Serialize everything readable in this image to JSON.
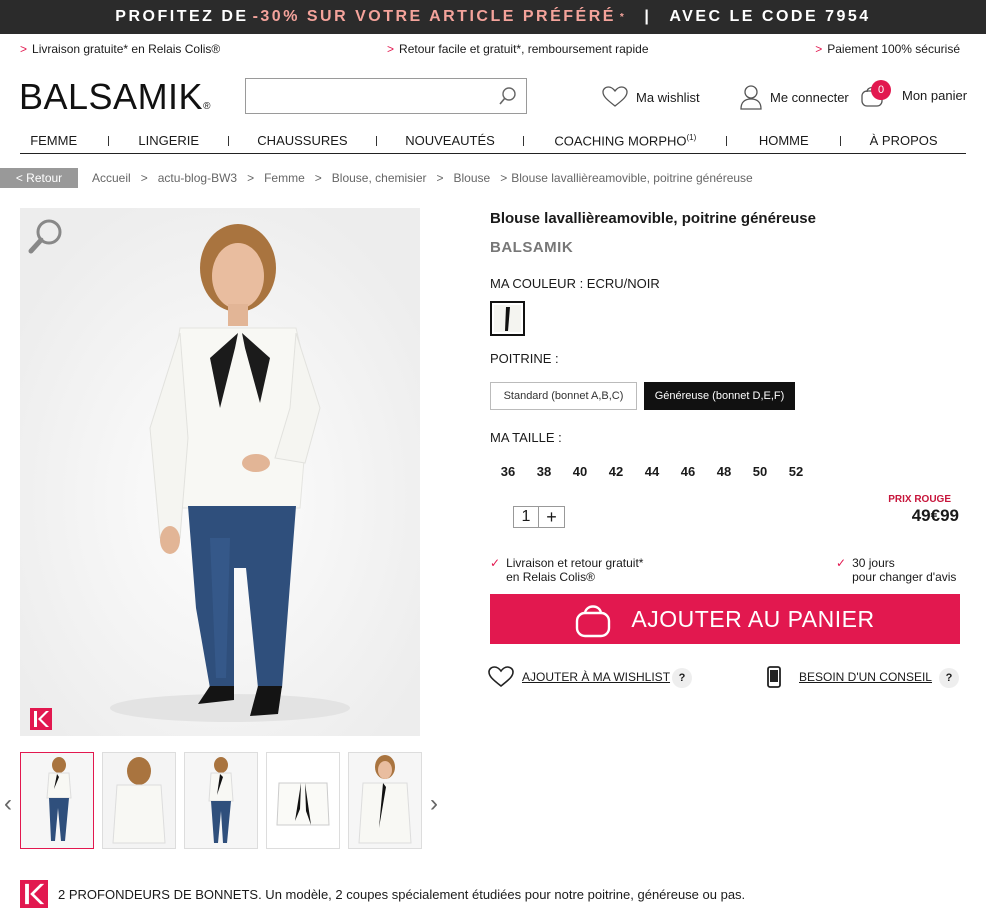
{
  "promo": {
    "part1": "PROFITEZ DE",
    "accent": "-30% SUR VOTRE ARTICLE PRÉFÉRÉ",
    "star": "*",
    "sep": "|",
    "part2": "AVEC LE CODE 7954"
  },
  "infobar": {
    "chevron": ">",
    "items": [
      "Livraison gratuite* en Relais Colis®",
      "Retour facile et gratuit*, remboursement rapide",
      "Paiement 100% sécurisé"
    ]
  },
  "header": {
    "logo": "BALSAMIK",
    "logo_reg": "®",
    "search_placeholder": "",
    "wishlist": "Ma wishlist",
    "login": "Me connecter",
    "cart_count": "0",
    "cart": "Mon panier"
  },
  "nav": {
    "items": [
      "FEMME",
      "LINGERIE",
      "CHAUSSURES",
      "NOUVEAUTÉS",
      "COACHING MORPHO",
      "HOMME",
      "À PROPOS"
    ],
    "coaching_sup": "(1)"
  },
  "breadcrumb": {
    "back": "< Retour",
    "sep": ">",
    "items": [
      "Accueil",
      "actu-blog-BW3",
      "Femme",
      "Blouse, chemisier",
      "Blouse",
      "Blouse lavallièreamovible, poitrine généreuse"
    ]
  },
  "product": {
    "title": "Blouse lavallièreamovible, poitrine généreuse",
    "brand": "BALSAMIK",
    "color_label": "MA COULEUR : ECRU/NOIR",
    "bust_label": "POITRINE :",
    "bust_options": [
      "Standard (bonnet A,B,C)",
      "Généreuse (bonnet D,E,F)"
    ],
    "size_label": "MA TAILLE :",
    "sizes": [
      "36",
      "38",
      "40",
      "42",
      "44",
      "46",
      "48",
      "50",
      "52"
    ],
    "quantity": "1",
    "plus": "+",
    "price_label": "PRIX ROUGE",
    "price": "49€99",
    "tick": "✓",
    "delivery_line1": "Livraison et retour gratuit*",
    "delivery_line2": "en Relais Colis®",
    "returns_line1": "30 jours",
    "returns_line2": "pour changer d'avis",
    "add_to_cart": "AJOUTER AU PANIER",
    "add_wishlist": "AJOUTER À MA WISHLIST",
    "advice": "BESOIN D'UN CONSEIL",
    "help": "?"
  },
  "gallery": {
    "prev": "‹",
    "next": "›"
  },
  "footer_note": "2 PROFONDEURS DE BONNETS. Un modèle, 2 coupes spécialement étudiées pour notre poitrine, généreuse ou pas.",
  "colors": {
    "accent": "#e2184f",
    "promo_bg": "#2b2b2b",
    "price_red": "#c7153b"
  }
}
